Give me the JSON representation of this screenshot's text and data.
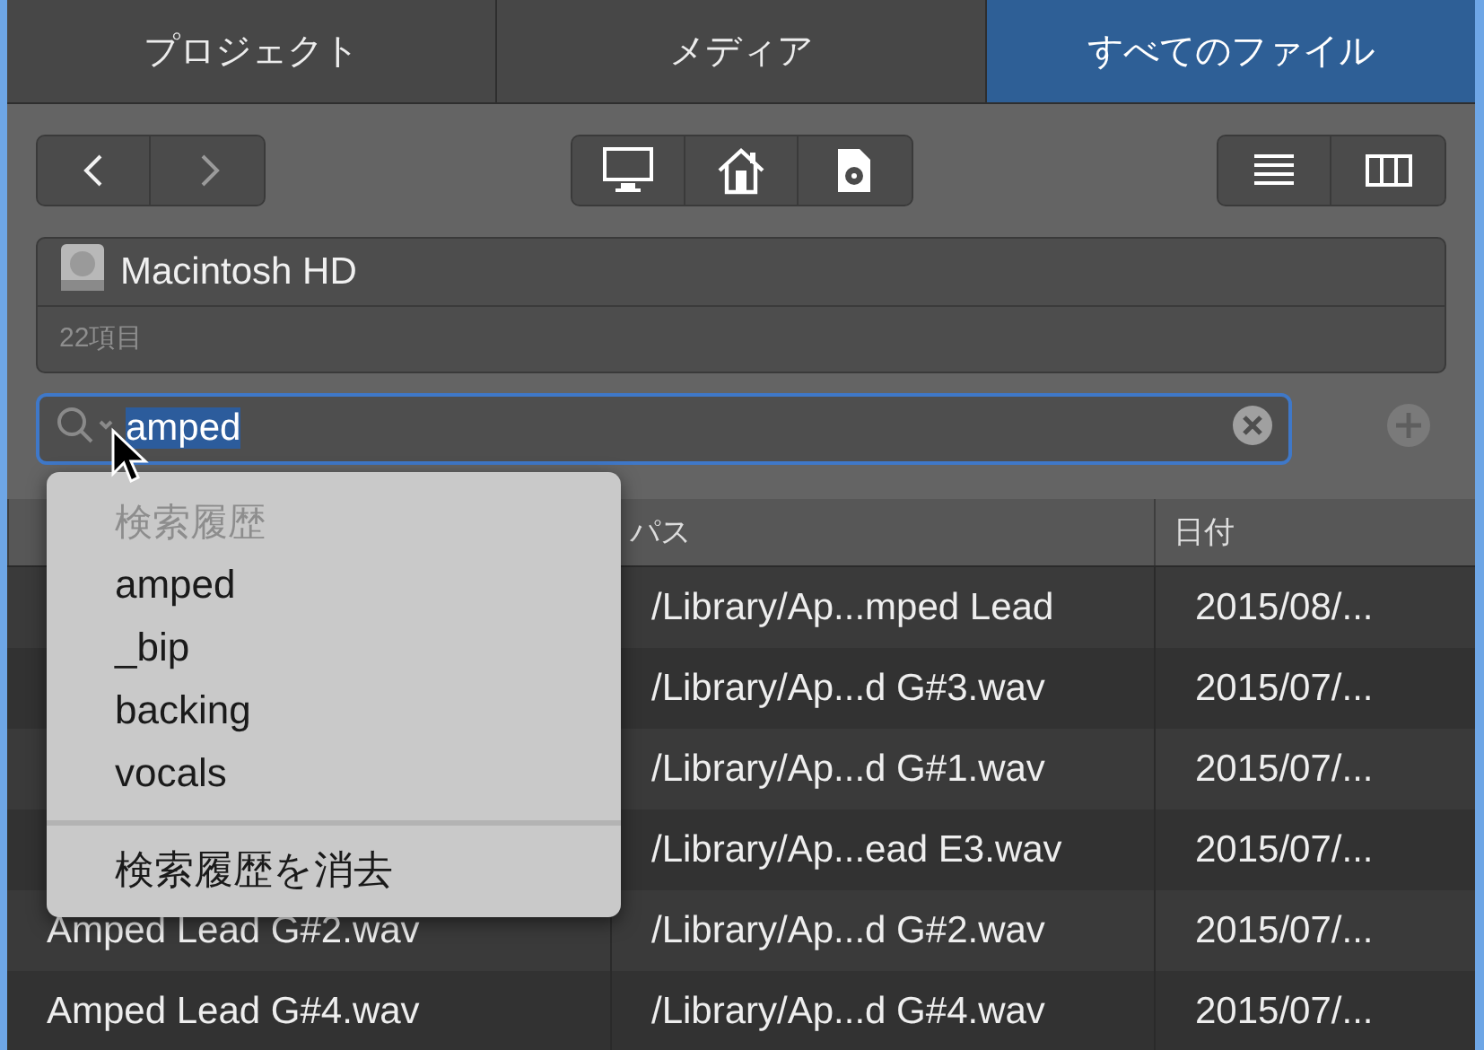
{
  "tabs": [
    {
      "label": "プロジェクト",
      "selected": false
    },
    {
      "label": "メディア",
      "selected": false
    },
    {
      "label": "すべてのファイル",
      "selected": true
    }
  ],
  "navigation": [
    {
      "kind": "back",
      "disabled": false
    },
    {
      "kind": "forward",
      "disabled": true
    }
  ],
  "location": {
    "name": "Macintosh HD",
    "count": "22項目"
  },
  "search": {
    "value": "amped"
  },
  "search_history": {
    "title": "検索履歴",
    "items": [
      "amped",
      "_bip",
      "backing",
      "vocals"
    ],
    "clear_label": "検索履歴を消去"
  },
  "table": {
    "columns": [
      {
        "label": "パス"
      },
      {
        "label": "日付"
      }
    ],
    "rows": [
      {
        "path": "/Library/Ap...mped Lead",
        "date": "2015/08/..."
      },
      {
        "path": "/Library/Ap...d G#3.wav",
        "date": "2015/07/..."
      },
      {
        "path": "/Library/Ap...d G#1.wav",
        "date": "2015/07/..."
      },
      {
        "path": "/Library/Ap...ead E3.wav",
        "date": "2015/07/..."
      },
      {
        "name": "Amped Lead G#2.wav",
        "path": "/Library/Ap...d G#2.wav",
        "date": "2015/07/..."
      },
      {
        "name": "Amped Lead G#4.wav",
        "path": "/Library/Ap...d G#4.wav",
        "date": "2015/07/..."
      }
    ]
  }
}
